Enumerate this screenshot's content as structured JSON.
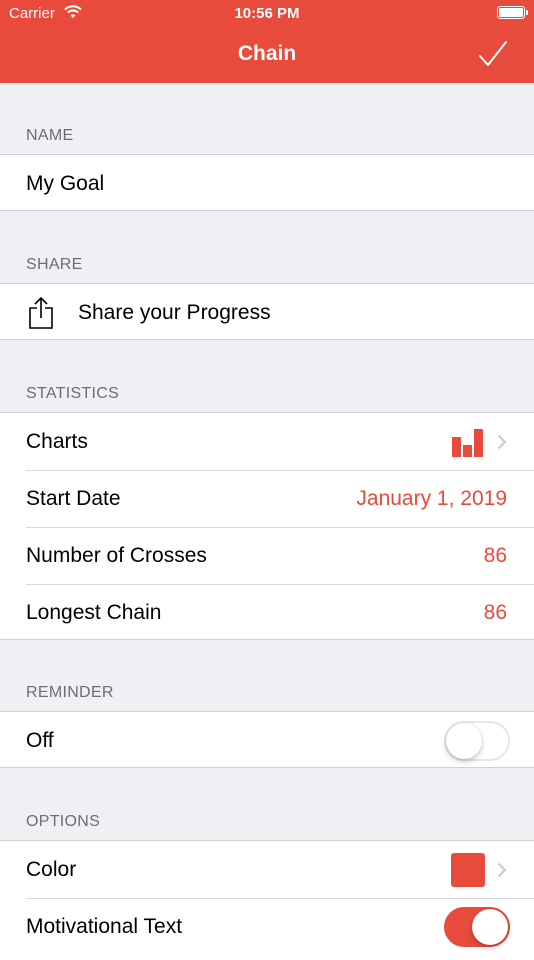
{
  "status_bar": {
    "carrier": "Carrier",
    "time": "10:56 PM"
  },
  "nav": {
    "title": "Chain",
    "done_icon": "checkmark-icon"
  },
  "colors": {
    "accent": "#e84a3c",
    "background": "#efeff4",
    "header_text": "#6d6d72"
  },
  "sections": {
    "name": {
      "header": "NAME",
      "value": "My Goal"
    },
    "share": {
      "header": "SHARE",
      "label": "Share your Progress",
      "icon": "share-icon"
    },
    "statistics": {
      "header": "STATISTICS",
      "charts_label": "Charts",
      "start_date_label": "Start Date",
      "start_date_value": "January 1, 2019",
      "crosses_label": "Number of Crosses",
      "crosses_value": "86",
      "longest_label": "Longest Chain",
      "longest_value": "86"
    },
    "reminder": {
      "header": "REMINDER",
      "label": "Off",
      "toggle_on": false
    },
    "options": {
      "header": "OPTIONS",
      "color_label": "Color",
      "color_value": "#e84a3c",
      "motivational_label": "Motivational Text",
      "motivational_on": true
    }
  }
}
